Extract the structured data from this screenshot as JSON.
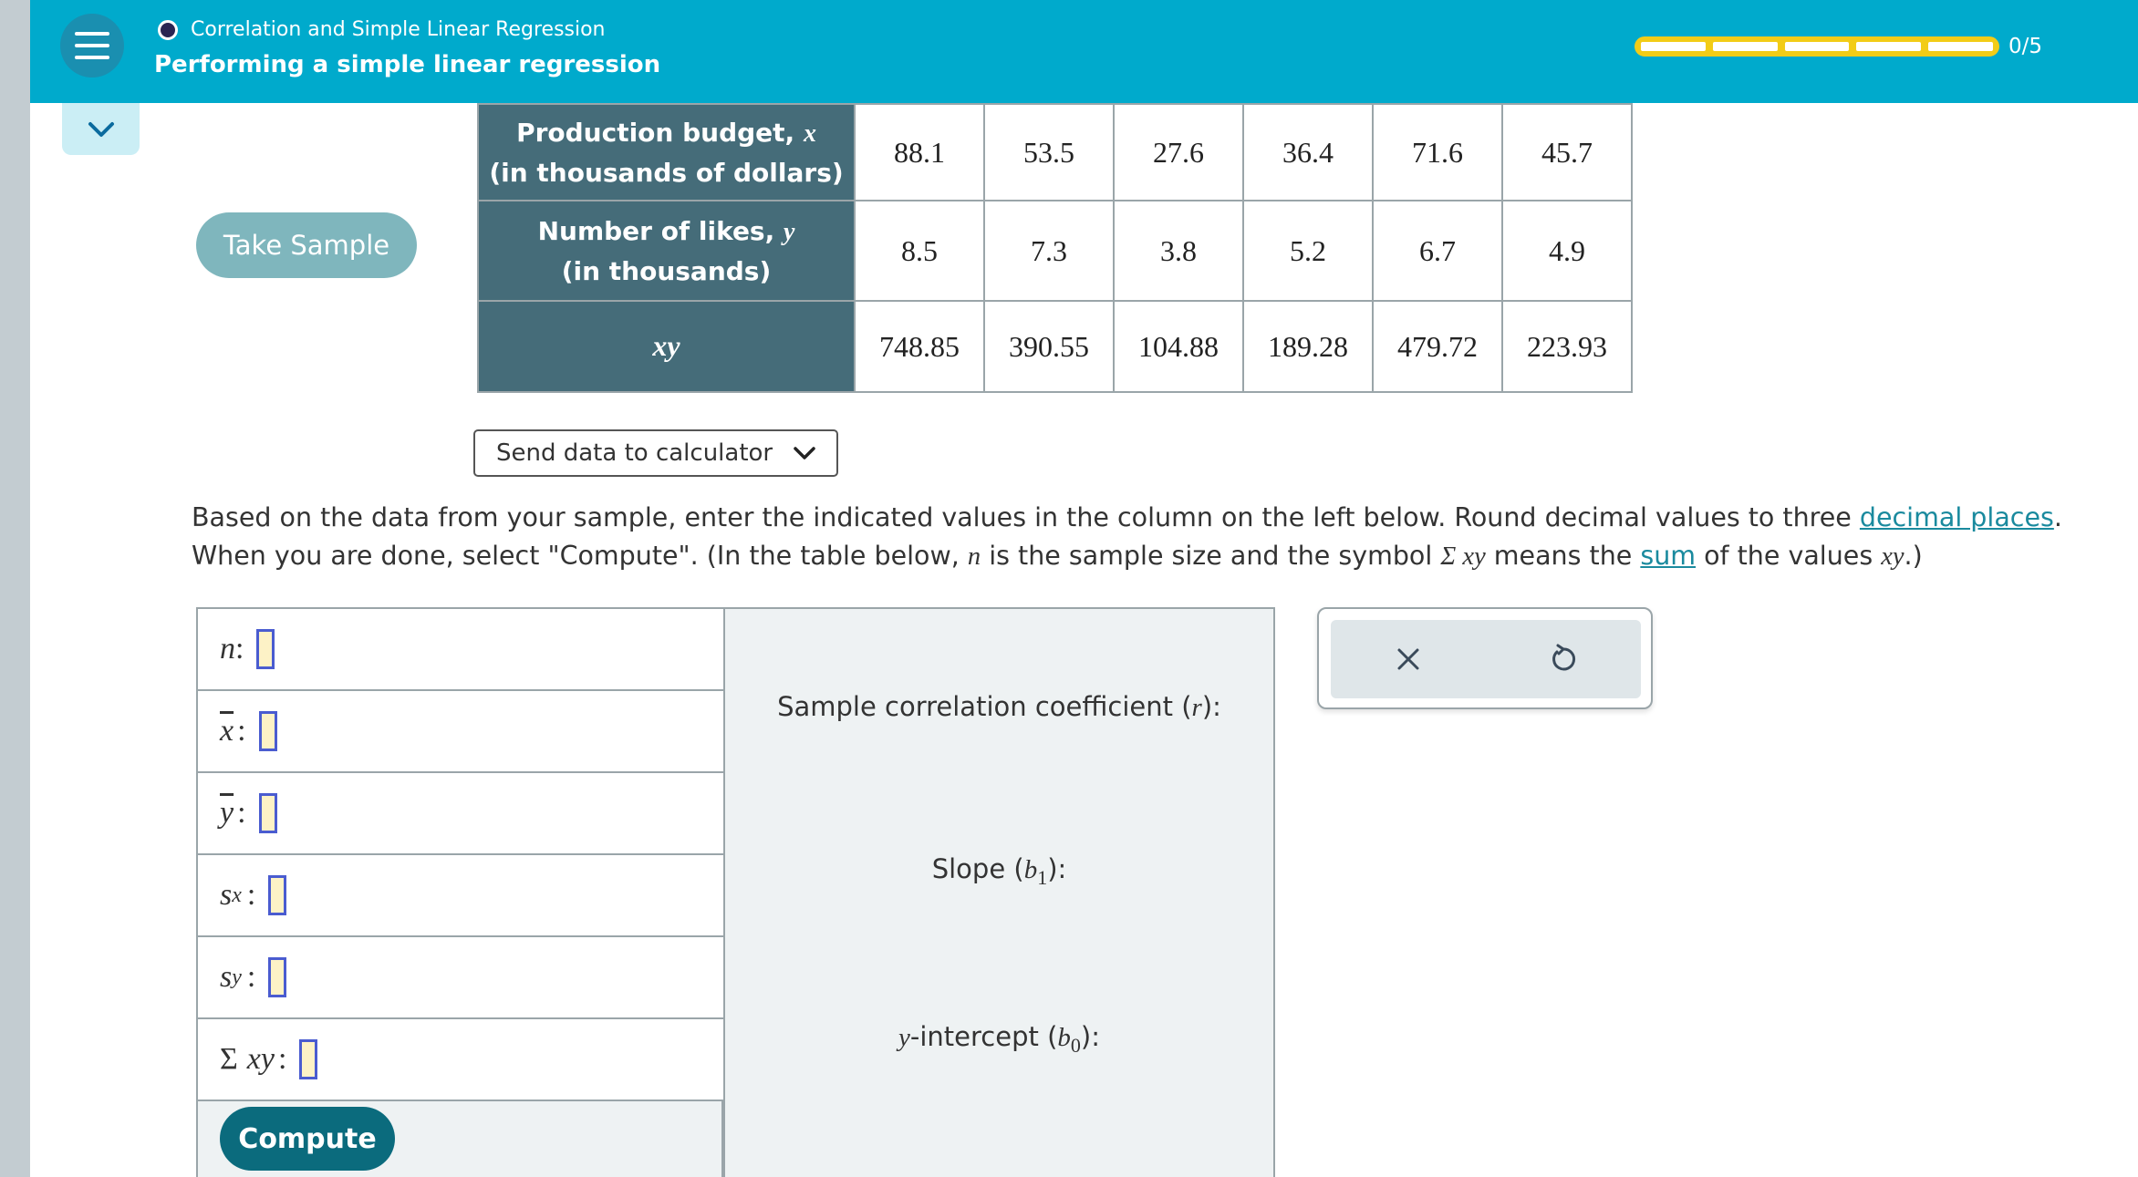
{
  "header": {
    "topic": "Correlation and Simple Linear Regression",
    "title": "Performing a simple linear regression",
    "progress": {
      "completed": 0,
      "total": 5,
      "label": "0/5"
    },
    "accent_color": "#00aacc",
    "progress_color": "#f2cc17"
  },
  "take_sample_label": "Take Sample",
  "data_table": {
    "rows": [
      {
        "header_line1": "Production budget, ",
        "header_var": "x",
        "header_line2": "(in thousands of dollars)",
        "values": [
          "88.1",
          "53.5",
          "27.6",
          "36.4",
          "71.6",
          "45.7"
        ]
      },
      {
        "header_line1": "Number of likes, ",
        "header_var": "y",
        "header_line2": "(in thousands)",
        "values": [
          "8.5",
          "7.3",
          "3.8",
          "5.2",
          "6.7",
          "4.9"
        ]
      },
      {
        "header_var": "xy",
        "values": [
          "748.85",
          "390.55",
          "104.88",
          "189.28",
          "479.72",
          "223.93"
        ]
      }
    ]
  },
  "send_data_label": "Send data to calculator",
  "instructions": {
    "part1": "Based on the data from your sample, enter the indicated values in the column on the left below. Round decimal values to three ",
    "link1": "decimal places",
    "part2": ". When you are done, select \"Compute\". (In the table below, ",
    "n": "n",
    "part3": " is the sample size and the symbol ",
    "sigma_xy": "Σ xy",
    "part4": " means the ",
    "link2": "sum",
    "part5": " of the values ",
    "xy": "xy",
    "part6": ".)"
  },
  "inputs": {
    "n": "n",
    "xbar": "x",
    "ybar": "y",
    "sx_s": "s",
    "sx_sub": "x",
    "sy_s": "s",
    "sy_sub": "y",
    "sigma": "Σ",
    "sigma_xy": "xy",
    "colon": ":"
  },
  "compute_label": "Compute",
  "outputs": {
    "r_text": "Sample correlation coefficient (",
    "r_var": "r",
    "r_end": "):",
    "slope_text": "Slope (",
    "slope_var": "b",
    "slope_sub": "1",
    "slope_end": "):",
    "intercept_var": "y",
    "intercept_text": "-intercept (",
    "intercept_b": "b",
    "intercept_sub": "0",
    "intercept_end": "):"
  },
  "actions": {
    "clear_icon": "close-icon",
    "reset_icon": "undo-icon"
  }
}
